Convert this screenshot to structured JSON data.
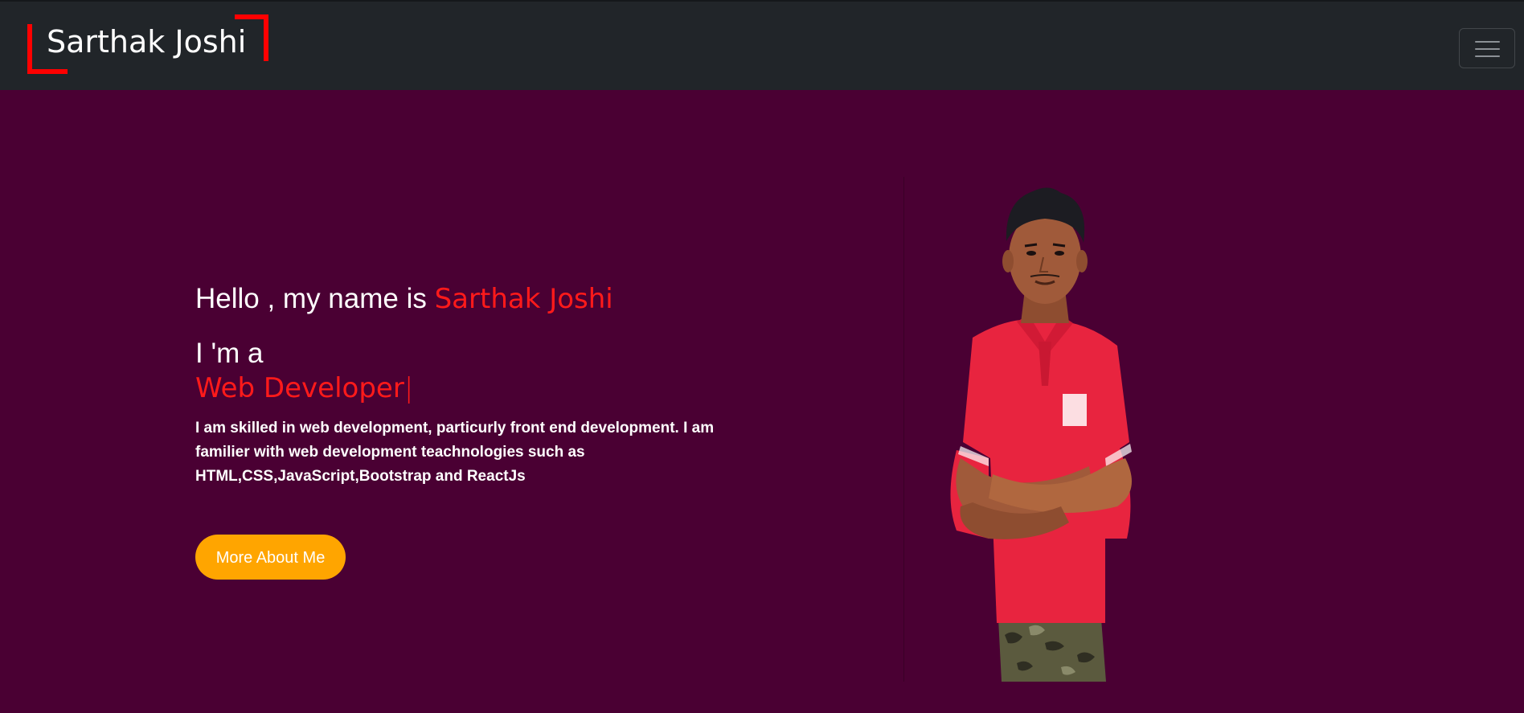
{
  "navbar": {
    "brand": "Sarthak Joshi",
    "toggle_icon": "hamburger-icon"
  },
  "hero": {
    "greeting_prefix": "Hello , my name is ",
    "greeting_name": "Sarthak Joshi",
    "role_prefix": "I 'm a",
    "role": "Web Developer",
    "cursor": "|",
    "bio": "I am skilled in web development, particurly front end development. I am familier with web development teachnologies such as HTML,CSS,JavaScript,Bootstrap and ReactJs",
    "button_label": "More About Me"
  },
  "colors": {
    "background": "#4a0033",
    "navbar": "#212529",
    "accent_red": "#ff1a1a",
    "button": "#ffa500"
  }
}
